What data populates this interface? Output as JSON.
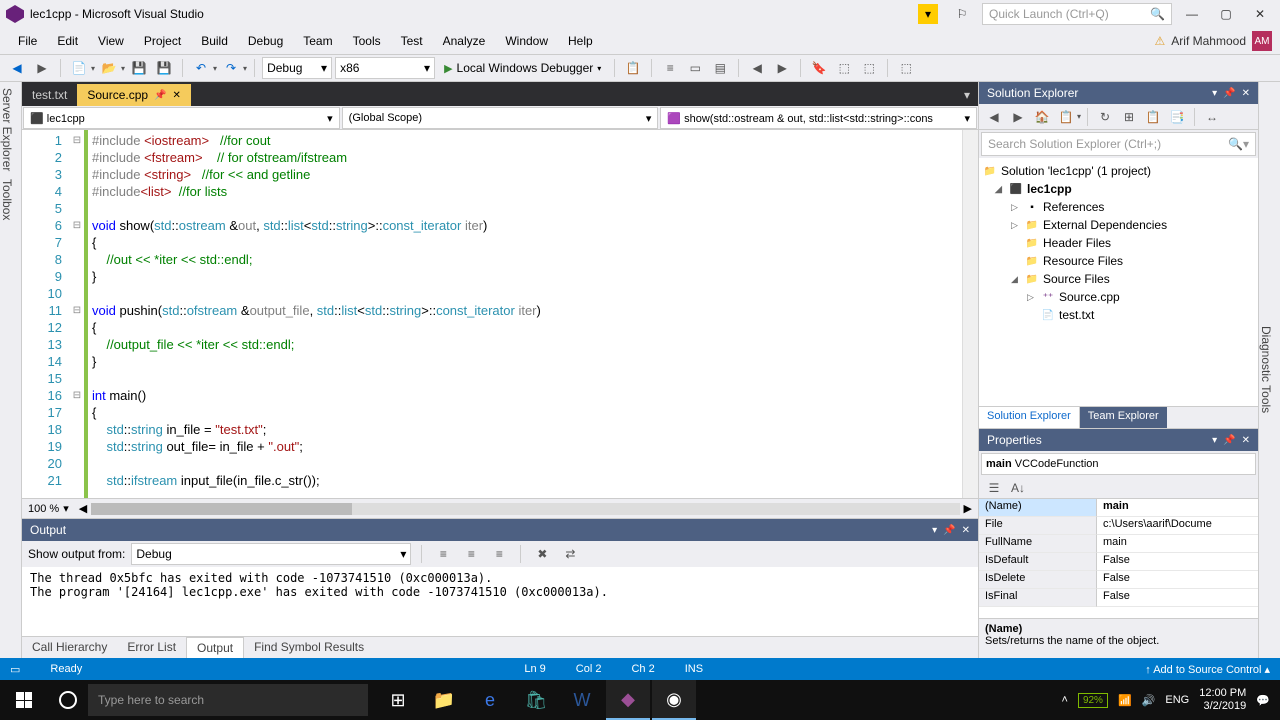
{
  "title": "lec1cpp - Microsoft Visual Studio",
  "quick_launch_placeholder": "Quick Launch (Ctrl+Q)",
  "user_name": "Arif Mahmood",
  "user_initials": "AM",
  "menu": [
    "File",
    "Edit",
    "View",
    "Project",
    "Build",
    "Debug",
    "Team",
    "Tools",
    "Test",
    "Analyze",
    "Window",
    "Help"
  ],
  "toolbar": {
    "config": "Debug",
    "platform": "x86",
    "debugger": "Local Windows Debugger"
  },
  "tabs": [
    {
      "label": "test.txt",
      "active": false
    },
    {
      "label": "Source.cpp",
      "active": true
    }
  ],
  "nav": {
    "scope1": "lec1cpp",
    "scope2": "(Global Scope)",
    "scope3": "show(std::ostream & out, std::list<std::string>::cons"
  },
  "code_lines": [
    {
      "n": 1,
      "fold": "⊟",
      "html": "<span class='pp'>#include</span> <span class='str'>&lt;iostream&gt;</span>   <span class='cm'>//for cout</span>"
    },
    {
      "n": 2,
      "fold": "",
      "html": "<span class='pp'>#include</span> <span class='str'>&lt;fstream&gt;</span>    <span class='cm'>// for ofstream/ifstream</span>"
    },
    {
      "n": 3,
      "fold": "",
      "html": "<span class='pp'>#include</span> <span class='str'>&lt;string&gt;</span>   <span class='cm'>//for &lt;&lt; and getline</span>"
    },
    {
      "n": 4,
      "fold": "",
      "html": "<span class='pp'>#include</span><span class='str'>&lt;list&gt;</span>  <span class='cm'>//for lists</span>"
    },
    {
      "n": 5,
      "fold": "",
      "html": ""
    },
    {
      "n": 6,
      "fold": "⊟",
      "html": "<span class='kw'>void</span> show(<span class='typ'>std</span>::<span class='typ'>ostream</span> &amp;<span class='pp'>out</span>, <span class='typ'>std</span>::<span class='typ'>list</span>&lt;<span class='typ'>std</span>::<span class='typ'>string</span>&gt;::<span class='typ'>const_iterator</span> <span class='pp'>iter</span>)"
    },
    {
      "n": 7,
      "fold": "",
      "html": "{"
    },
    {
      "n": 8,
      "fold": "",
      "html": "    <span class='cm'>//out &lt;&lt; *iter &lt;&lt; std::endl;</span>"
    },
    {
      "n": 9,
      "fold": "",
      "html": "}"
    },
    {
      "n": 10,
      "fold": "",
      "html": ""
    },
    {
      "n": 11,
      "fold": "⊟",
      "html": "<span class='kw'>void</span> pushin(<span class='typ'>std</span>::<span class='typ'>ofstream</span> &amp;<span class='pp'>output_file</span>, <span class='typ'>std</span>::<span class='typ'>list</span>&lt;<span class='typ'>std</span>::<span class='typ'>string</span>&gt;::<span class='typ'>const_iterator</span> <span class='pp'>iter</span>)"
    },
    {
      "n": 12,
      "fold": "",
      "html": "{"
    },
    {
      "n": 13,
      "fold": "",
      "html": "    <span class='cm'>//output_file &lt;&lt; *iter &lt;&lt; std::endl;</span>"
    },
    {
      "n": 14,
      "fold": "",
      "html": "}"
    },
    {
      "n": 15,
      "fold": "",
      "html": ""
    },
    {
      "n": 16,
      "fold": "⊟",
      "html": "<span class='kw'>int</span> main()"
    },
    {
      "n": 17,
      "fold": "",
      "html": "{"
    },
    {
      "n": 18,
      "fold": "",
      "html": "    <span class='typ'>std</span>::<span class='typ'>string</span> in_file = <span class='str'>\"test.txt\"</span>;"
    },
    {
      "n": 19,
      "fold": "",
      "html": "    <span class='typ'>std</span>::<span class='typ'>string</span> out_file= in_file + <span class='str'>\".out\"</span>;"
    },
    {
      "n": 20,
      "fold": "",
      "html": ""
    },
    {
      "n": 21,
      "fold": "",
      "html": "    <span class='typ'>std</span>::<span class='typ'>ifstream</span> input_file(in_file.c_str());"
    }
  ],
  "zoom": "100 %",
  "output": {
    "title": "Output",
    "from_label": "Show output from:",
    "from_value": "Debug",
    "lines": [
      "The thread 0x5bfc has exited with code -1073741510 (0xc000013a).",
      "The program '[24164] lec1cpp.exe' has exited with code -1073741510 (0xc000013a)."
    ]
  },
  "bottom_tabs": [
    "Call Hierarchy",
    "Error List",
    "Output",
    "Find Symbol Results"
  ],
  "bottom_tab_active": 2,
  "sln": {
    "title": "Solution Explorer",
    "search_placeholder": "Search Solution Explorer (Ctrl+;)",
    "root": "Solution 'lec1cpp' (1 project)",
    "project": "lec1cpp",
    "folders": [
      "References",
      "External Dependencies",
      "Header Files",
      "Resource Files",
      "Source Files"
    ],
    "files": [
      "Source.cpp",
      "test.txt"
    ],
    "tabs": [
      "Solution Explorer",
      "Team Explorer"
    ]
  },
  "props": {
    "title": "Properties",
    "obj": "main VCCodeFunction",
    "rows": [
      {
        "name": "(Name)",
        "val": "main",
        "sel": true
      },
      {
        "name": "File",
        "val": "c:\\Users\\aarif\\Docume"
      },
      {
        "name": "FullName",
        "val": "main"
      },
      {
        "name": "IsDefault",
        "val": "False"
      },
      {
        "name": "IsDelete",
        "val": "False"
      },
      {
        "name": "IsFinal",
        "val": "False"
      }
    ],
    "desc_title": "(Name)",
    "desc_body": "Sets/returns the name of the object."
  },
  "status": {
    "ready": "Ready",
    "ln": "Ln 9",
    "col": "Col 2",
    "ch": "Ch 2",
    "ins": "INS",
    "scm": "Add to Source Control"
  },
  "taskbar": {
    "search": "Type here to search",
    "battery": "92%",
    "lang": "ENG",
    "time": "12:00 PM",
    "date": "3/2/2019"
  }
}
